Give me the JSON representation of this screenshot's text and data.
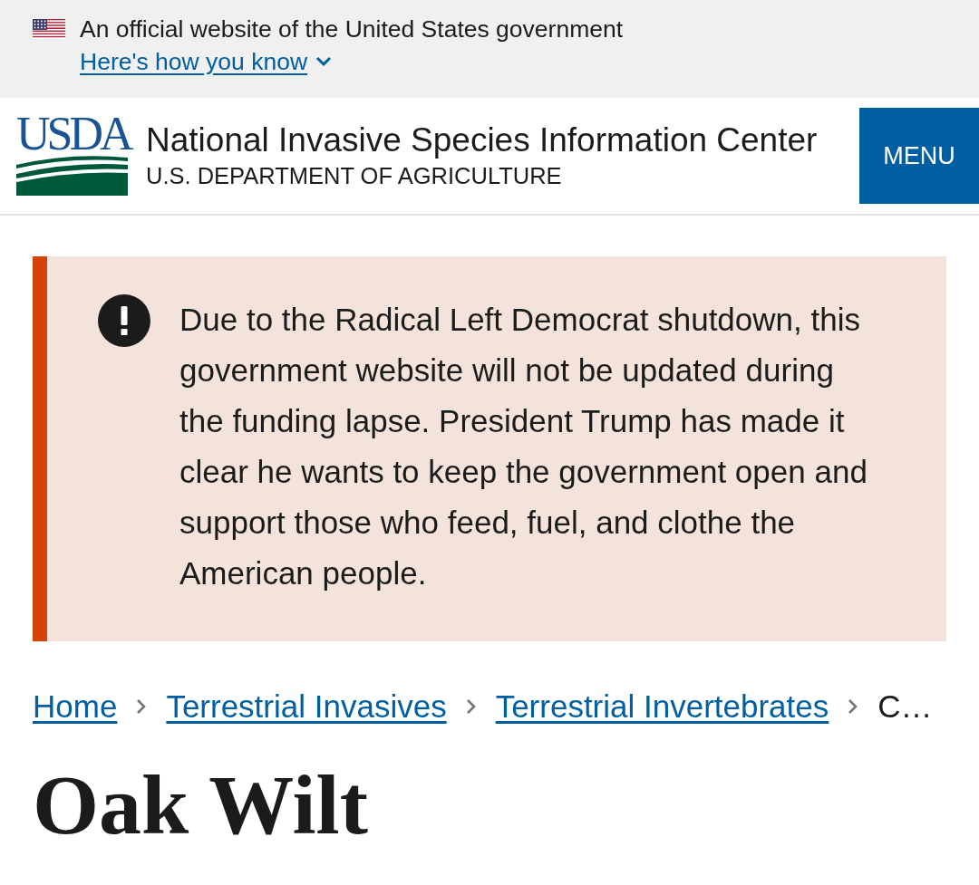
{
  "banner": {
    "text": "An official website of the United States government",
    "link": "Here's how you know",
    "expanded": false
  },
  "header": {
    "logo_text": "USDA",
    "title": "National Invasive Species Information Center",
    "subtitle": "U.S. DEPARTMENT OF AGRICULTURE",
    "menu_button": "MENU"
  },
  "alert": {
    "text": "Due to the Radical Left Democrat shutdown, this government website will not be updated during the funding lapse. President Trump has made it clear he wants to keep the government open and support those who feed, fuel, and clothe the American people."
  },
  "breadcrumb": [
    {
      "label": "Home",
      "kind": "link"
    },
    {
      "label": "Terrestrial Invasives",
      "kind": "link"
    },
    {
      "label": "Terrestrial Invertebrates",
      "kind": "link"
    },
    {
      "label": "C…",
      "kind": "current"
    }
  ],
  "page_title": "Oak Wilt"
}
